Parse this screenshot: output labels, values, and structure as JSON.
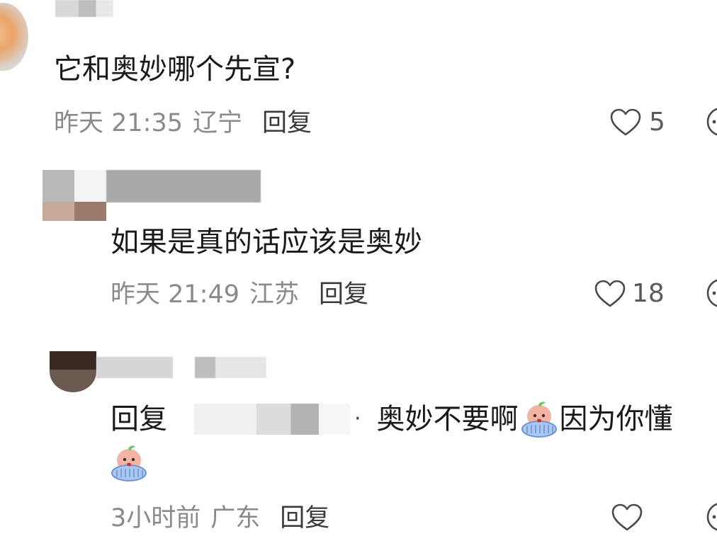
{
  "comments": [
    {
      "text": "它和奥妙哪个先宣?",
      "time": "昨天 21:35",
      "location": "辽宁",
      "reply_label": "回复",
      "likes": "5"
    },
    {
      "text": "如果是真的话应该是奥妙",
      "time": "昨天 21:49",
      "location": "江苏",
      "reply_label": "回复",
      "likes": "18"
    },
    {
      "reply_prefix": "回复",
      "separator": "·",
      "text_part1": "奥妙不要啊",
      "text_part2": "因为你懂",
      "time": "3小时前",
      "location": "广东",
      "reply_label": "回复",
      "likes": ""
    }
  ],
  "icons": {
    "like": "heart-outline-icon",
    "more": "more-options-icon",
    "sticker": "crying-peach-sticker"
  },
  "colors": {
    "text": "#1a1a1a",
    "meta": "#8a8a8a",
    "icon": "#4a4a4a"
  }
}
